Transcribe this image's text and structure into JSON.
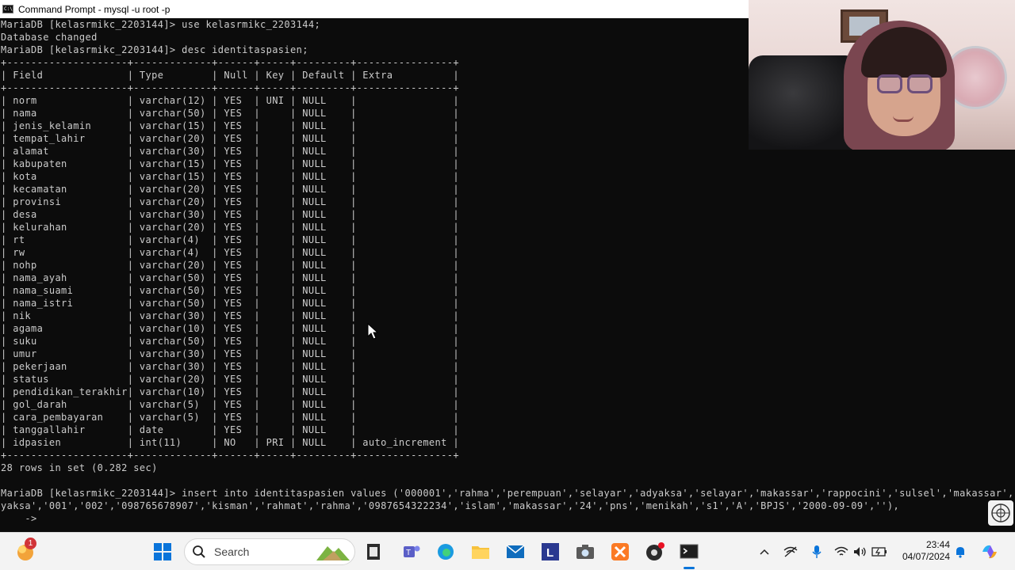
{
  "window": {
    "title": "Command Prompt - mysql  -u root -p",
    "icon_label": "C:\\"
  },
  "console_lines": [
    "MariaDB [kelasrmikc_2203144]> use kelasrmikc_2203144;",
    "Database changed",
    "MariaDB [kelasrmikc_2203144]> desc identitaspasien;",
    "+--------------------+-------------+------+-----+---------+----------------+",
    "| Field              | Type        | Null | Key | Default | Extra          |",
    "+--------------------+-------------+------+-----+---------+----------------+",
    "| norm               | varchar(12) | YES  | UNI | NULL    |                |",
    "| nama               | varchar(50) | YES  |     | NULL    |                |",
    "| jenis_kelamin      | varchar(15) | YES  |     | NULL    |                |",
    "| tempat_lahir       | varchar(20) | YES  |     | NULL    |                |",
    "| alamat             | varchar(30) | YES  |     | NULL    |                |",
    "| kabupaten          | varchar(15) | YES  |     | NULL    |                |",
    "| kota               | varchar(15) | YES  |     | NULL    |                |",
    "| kecamatan          | varchar(20) | YES  |     | NULL    |                |",
    "| provinsi           | varchar(20) | YES  |     | NULL    |                |",
    "| desa               | varchar(30) | YES  |     | NULL    |                |",
    "| kelurahan          | varchar(20) | YES  |     | NULL    |                |",
    "| rt                 | varchar(4)  | YES  |     | NULL    |                |",
    "| rw                 | varchar(4)  | YES  |     | NULL    |                |",
    "| nohp               | varchar(20) | YES  |     | NULL    |                |",
    "| nama_ayah          | varchar(50) | YES  |     | NULL    |                |",
    "| nama_suami         | varchar(50) | YES  |     | NULL    |                |",
    "| nama_istri         | varchar(50) | YES  |     | NULL    |                |",
    "| nik                | varchar(30) | YES  |     | NULL    |                |",
    "| agama              | varchar(10) | YES  |     | NULL    |                |",
    "| suku               | varchar(50) | YES  |     | NULL    |                |",
    "| umur               | varchar(30) | YES  |     | NULL    |                |",
    "| pekerjaan          | varchar(30) | YES  |     | NULL    |                |",
    "| status             | varchar(20) | YES  |     | NULL    |                |",
    "| pendidikan_terakhir| varchar(10) | YES  |     | NULL    |                |",
    "| gol_darah          | varchar(5)  | YES  |     | NULL    |                |",
    "| cara_pembayaran    | varchar(5)  | YES  |     | NULL    |                |",
    "| tanggallahir       | date        | YES  |     | NULL    |                |",
    "| idpasien           | int(11)     | NO   | PRI | NULL    | auto_increment |",
    "+--------------------+-------------+------+-----+---------+----------------+",
    "28 rows in set (0.282 sec)",
    "",
    "MariaDB [kelasrmikc_2203144]> insert into identitaspasien values ('000001','rahma','perempuan','selayar','adyaksa','selayar','makassar','rappocini','sulsel','makassar','adh",
    "yaksa','001','002','098765678907','kisman','rahmat','rahma','0987654322234','islam','makassar','24','pns','menikah','s1','A','BPJS','2000-09-09',''),",
    "    ->"
  ],
  "taskbar": {
    "search_label": "Search",
    "notification_count": "1",
    "time": "23:44",
    "date": "04/07/2024",
    "apps": [
      "widgets-icon",
      "start-icon",
      "search-icon",
      "file-icon",
      "teams-icon",
      "edge-icon",
      "file-explorer-icon",
      "mail-icon",
      "l-app-icon",
      "camera-icon",
      "xampp-icon",
      "obs-icon",
      "command-prompt-icon"
    ],
    "tray": [
      "chevron-up-icon",
      "network-icon",
      "microphone-icon",
      "wifi-icon",
      "volume-icon",
      "battery-icon",
      "bell-icon",
      "copilot-icon"
    ]
  }
}
